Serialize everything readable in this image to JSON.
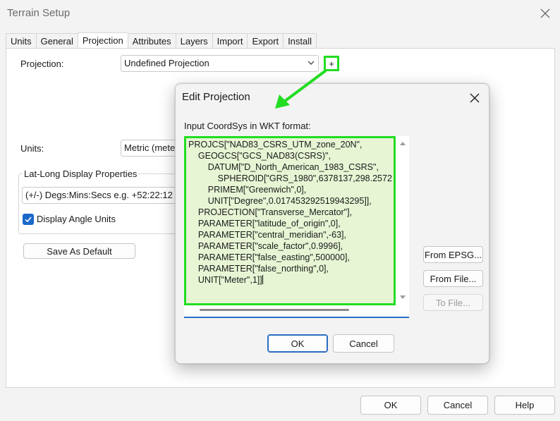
{
  "window": {
    "title": "Terrain Setup"
  },
  "tabs": [
    {
      "label": "Units"
    },
    {
      "label": "General"
    },
    {
      "label": "Projection"
    },
    {
      "label": "Attributes"
    },
    {
      "label": "Layers"
    },
    {
      "label": "Import"
    },
    {
      "label": "Export"
    },
    {
      "label": "Install"
    }
  ],
  "projection_tab": {
    "projection_label": "Projection:",
    "projection_value": "Undefined Projection",
    "add_button_label": "+",
    "units_label": "Units:",
    "units_value": "Metric (meters)",
    "latlong_group_title": "Lat-Long Display Properties",
    "latlong_format_value": "(+/-) Degs:Mins:Secs e.g. +52:22:12",
    "display_angle_units_label": "Display Angle Units",
    "display_angle_units_checked": true,
    "save_default_label": "Save As Default"
  },
  "footer": {
    "ok_label": "OK",
    "cancel_label": "Cancel",
    "help_label": "Help"
  },
  "edit_projection_dialog": {
    "title": "Edit Projection",
    "prompt_label": "Input CoordSys in WKT format:",
    "wkt_lines": [
      "PROJCS[\"NAD83_CSRS_UTM_zone_20N\",",
      "    GEOGCS[\"GCS_NAD83(CSRS)\",",
      "        DATUM[\"D_North_American_1983_CSRS\",",
      "            SPHEROID[\"GRS_1980\",6378137,298.2572",
      "        PRIMEM[\"Greenwich\",0],",
      "        UNIT[\"Degree\",0.017453292519943295]],",
      "    PROJECTION[\"Transverse_Mercator\"],",
      "    PARAMETER[\"latitude_of_origin\",0],",
      "    PARAMETER[\"central_meridian\",-63],",
      "    PARAMETER[\"scale_factor\",0.9996],",
      "    PARAMETER[\"false_easting\",500000],",
      "    PARAMETER[\"false_northing\",0],",
      "    UNIT[\"Meter\",1]]"
    ],
    "from_epsg_label": "From EPSG...",
    "from_file_label": "From File...",
    "to_file_label": "To File...",
    "ok_label": "OK",
    "cancel_label": "Cancel"
  },
  "colors": {
    "highlight": "#22dd22",
    "accent": "#2a6dc4",
    "wkt_background": "#e7f5d4"
  }
}
